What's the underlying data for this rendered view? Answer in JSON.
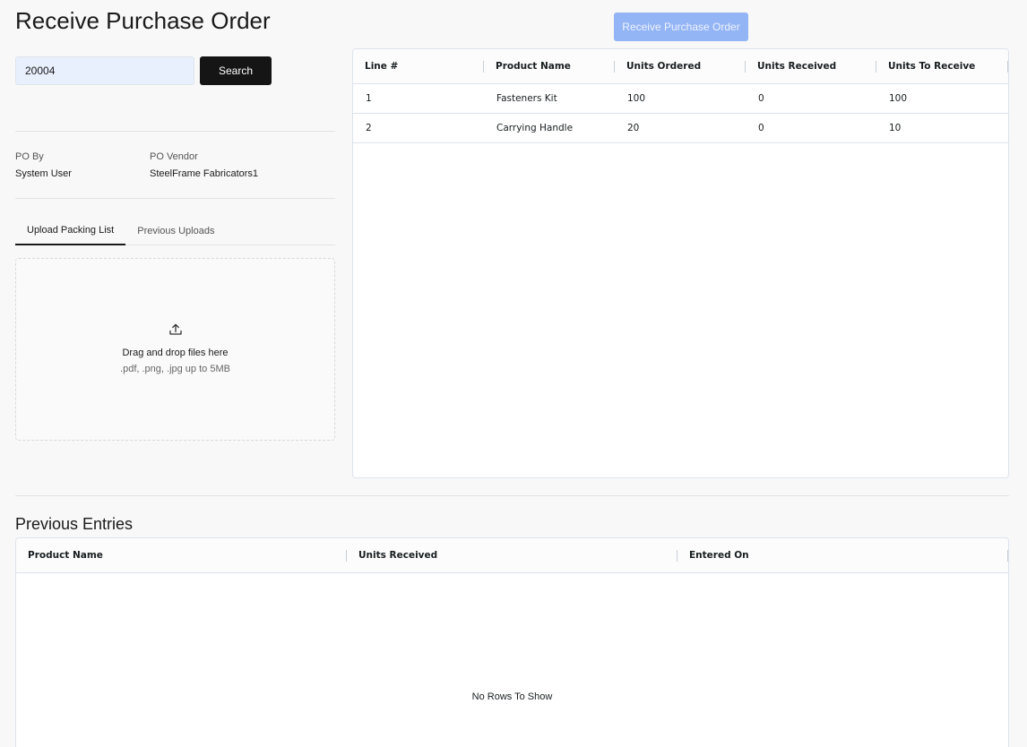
{
  "header": {
    "title": "Receive Purchase Order",
    "receive_button": "Receive Purchase Order"
  },
  "search": {
    "value": "20004",
    "button": "Search"
  },
  "po_info": {
    "po_by_label": "PO By",
    "po_by_value": "System User",
    "vendor_label": "PO Vendor",
    "vendor_value": "SteelFrame Fabricators1"
  },
  "tabs": [
    {
      "label": "Upload Packing List",
      "active": true
    },
    {
      "label": "Previous Uploads",
      "active": false
    }
  ],
  "dropzone": {
    "icon": "upload-icon",
    "main_text": "Drag and drop files here",
    "sub_text": ".pdf, .png, .jpg up to 5MB"
  },
  "lines_table": {
    "columns": [
      "Line #",
      "Product Name",
      "Units Ordered",
      "Units Received",
      "Units To Receive"
    ],
    "rows": [
      [
        "1",
        "Fasteners Kit",
        "100",
        "0",
        "100"
      ],
      [
        "2",
        "Carrying Handle",
        "20",
        "0",
        "10"
      ]
    ]
  },
  "previous_entries": {
    "title": "Previous Entries",
    "columns": [
      "Product Name",
      "Units Received",
      "Entered On"
    ],
    "empty_text": "No Rows To Show"
  },
  "colors": {
    "primary_disabled": "#93b4f5",
    "dark_button": "#151515",
    "input_bg": "#e8f0fe"
  }
}
